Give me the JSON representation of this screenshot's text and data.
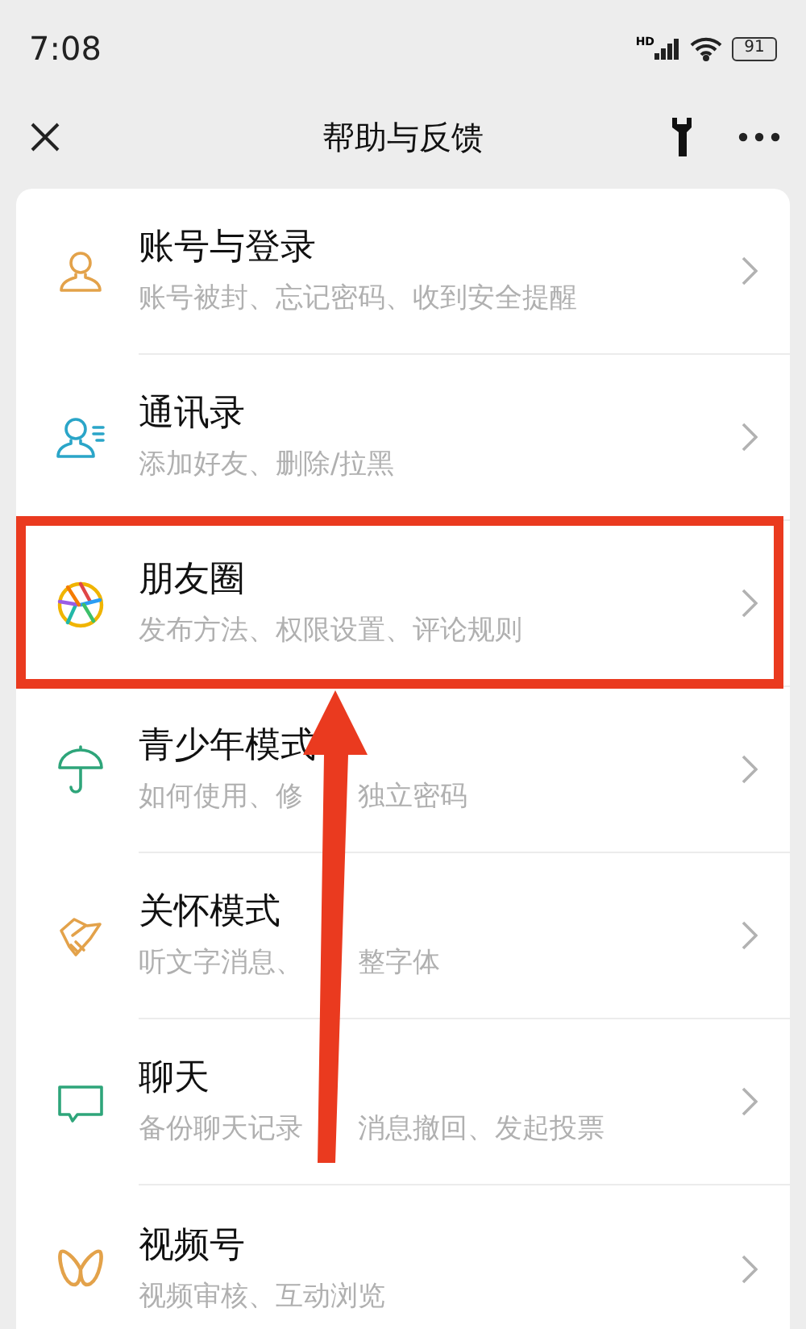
{
  "status_bar": {
    "time": "7:08",
    "signal_label": "HD",
    "battery": "91"
  },
  "header": {
    "title": "帮助与反馈"
  },
  "items": [
    {
      "title": "账号与登录",
      "subtitle": [
        "账号被封、忘记密码、收到安全提醒"
      ],
      "highlighted": false
    },
    {
      "title": "通讯录",
      "subtitle": [
        "添加好友、删除/拉黑"
      ],
      "highlighted": false
    },
    {
      "title": "朋友圈",
      "subtitle": [
        "发布方法、权限设置、评论规则"
      ],
      "highlighted": true
    },
    {
      "title": "青少年模式",
      "subtitle": [
        "如何使用、修",
        "独立密码"
      ],
      "highlighted": false
    },
    {
      "title": "关怀模式",
      "subtitle": [
        "听文字消息、",
        "整字体"
      ],
      "highlighted": false
    },
    {
      "title": "聊天",
      "subtitle": [
        "备份聊天记录",
        "消息撤回、发起投票"
      ],
      "highlighted": false
    },
    {
      "title": "视频号",
      "subtitle": [
        "视频审核、互动浏览"
      ],
      "highlighted": false
    }
  ]
}
